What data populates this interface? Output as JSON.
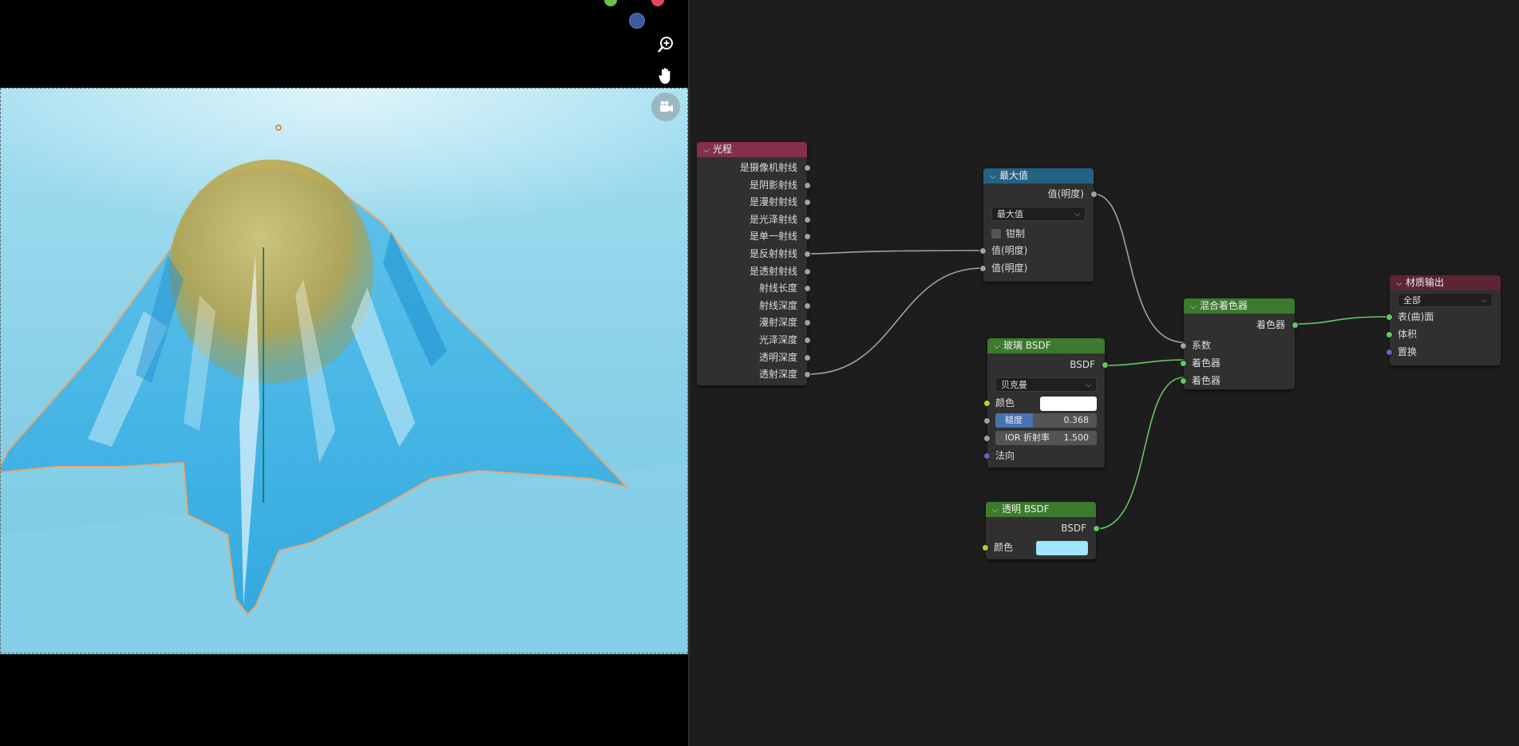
{
  "viewport": {
    "tools": [
      {
        "name": "zoom-icon"
      },
      {
        "name": "pan-hand-icon"
      },
      {
        "name": "camera-icon"
      }
    ]
  },
  "nodes": {
    "light_path": {
      "title": "光程",
      "color": "#83314a",
      "outputs": [
        "是摄像机射线",
        "是阴影射线",
        "是漫射射线",
        "是光泽射线",
        "是单一射线",
        "是反射射线",
        "是透射射线",
        "射线长度",
        "射线深度",
        "漫射深度",
        "光泽深度",
        "透明深度",
        "透射深度"
      ]
    },
    "maximum": {
      "title": "最大值",
      "color": "#246283",
      "output": "值(明度)",
      "operation": "最大值",
      "clamp_label": "钳制",
      "inputs": [
        "值(明度)",
        "值(明度)"
      ]
    },
    "glass": {
      "title": "玻璃 BSDF",
      "color": "#3c7a2e",
      "output": "BSDF",
      "distribution": "贝克曼",
      "color_label": "颜色",
      "color_value": "#ffffff",
      "roughness_label": "糙度",
      "roughness_value": "0.368",
      "roughness_fraction": 0.368,
      "ior_label": "IOR 折射率",
      "ior_value": "1.500",
      "normal_label": "法向"
    },
    "transparent": {
      "title": "透明 BSDF",
      "color": "#3c7a2e",
      "output": "BSDF",
      "color_label": "颜色",
      "color_value": "#9ee5ff"
    },
    "mix": {
      "title": "混合着色器",
      "color": "#3c7a2e",
      "output": "着色器",
      "inputs": [
        "系数",
        "着色器",
        "着色器"
      ]
    },
    "material_output": {
      "title": "材质输出",
      "color": "#5e2434",
      "target": "全部",
      "inputs": [
        "表(曲)面",
        "体积",
        "置换"
      ]
    }
  }
}
